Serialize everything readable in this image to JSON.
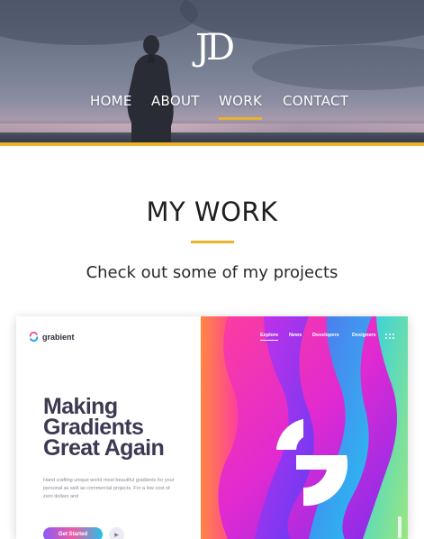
{
  "header": {
    "logo_text": "JD",
    "nav": [
      {
        "label": "HOME",
        "active": false
      },
      {
        "label": "ABOUT",
        "active": false
      },
      {
        "label": "WORK",
        "active": true
      },
      {
        "label": "CONTACT",
        "active": false
      }
    ]
  },
  "section": {
    "title": "MY WORK",
    "subtitle": "Check out some of my projects"
  },
  "project": {
    "brand": "grabient",
    "headline": [
      "Making",
      "Gradients",
      "Great Again"
    ],
    "description": "Hand crafting unique world most beautiful gradients for your personal as well as commercial projects. For a low cost of zero dollars and",
    "cta_label": "Get Started",
    "nav": [
      "Explore",
      "News",
      "Developers",
      "Designers"
    ],
    "active_nav": "Explore"
  },
  "colors": {
    "accent": "#e9b32a",
    "headline": "#3c3a52",
    "text": "#1f1f1f"
  },
  "icons": {
    "logo": "jd-monogram",
    "brand_mark": "grabient-logo-icon",
    "play": "play-icon",
    "menu_dots": "grid-dots-icon"
  }
}
